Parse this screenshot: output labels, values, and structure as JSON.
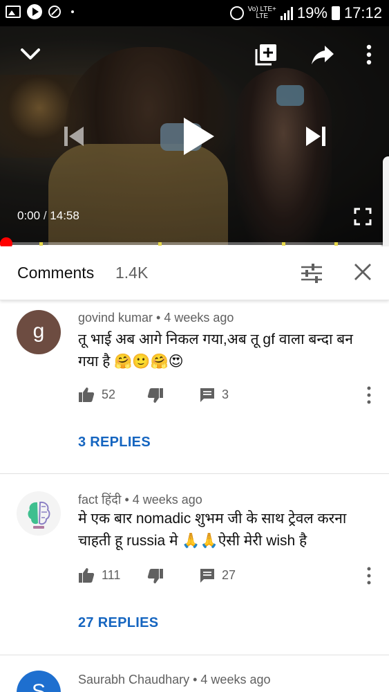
{
  "status_bar": {
    "network_top": "Vo) LTE+",
    "network_bottom": "LTE",
    "battery": "19%",
    "time": "17:12"
  },
  "player": {
    "current_time": "0:00",
    "separator": "/",
    "duration": "14:58",
    "progress": 0,
    "icons": [
      "chevron-down-icon",
      "add-to-queue-icon",
      "share-icon",
      "more-vert-icon",
      "skip-previous-icon",
      "play-icon",
      "skip-next-icon",
      "fullscreen-icon"
    ]
  },
  "comments_header": {
    "title": "Comments",
    "count": "1.4K"
  },
  "comments": [
    {
      "avatar_letter": "g",
      "avatar_color": "#6d4c41",
      "meta": "govind kumar • 4 weeks ago",
      "text": "तू भाई अब आगे निकल गया,अब तू gf वाला बन्दा बन गया है 🤗🙂🤗😍",
      "likes": "52",
      "replies_count": "3",
      "replies_link": "3 REPLIES"
    },
    {
      "avatar_letter": "",
      "avatar_color": "#f4f4f4",
      "meta": "fact हिंदी • 4 weeks ago",
      "text": "मे एक बार nomadic शुभम जी के साथ ट्रेवल करना चाहती हू russia मे 🙏🙏ऐसी मेरी wish  है",
      "likes": "111",
      "replies_count": "27",
      "replies_link": "27 REPLIES"
    },
    {
      "avatar_letter": "S",
      "avatar_color": "#1e6fcf",
      "meta": "Saurabh Chaudhary • 4 weeks ago"
    }
  ],
  "colors": {
    "accent_link": "#1565c0",
    "progress_scrubber": "#ff0000",
    "ad_marker": "#e6d84a"
  }
}
